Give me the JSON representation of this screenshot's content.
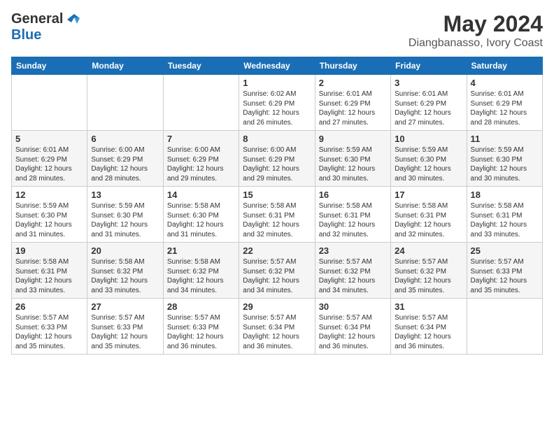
{
  "logo": {
    "line1": "General",
    "line2": "Blue"
  },
  "title": "May 2024",
  "location": "Diangbanasso, Ivory Coast",
  "headers": [
    "Sunday",
    "Monday",
    "Tuesday",
    "Wednesday",
    "Thursday",
    "Friday",
    "Saturday"
  ],
  "weeks": [
    [
      {
        "day": "",
        "sunrise": "",
        "sunset": "",
        "daylight": ""
      },
      {
        "day": "",
        "sunrise": "",
        "sunset": "",
        "daylight": ""
      },
      {
        "day": "",
        "sunrise": "",
        "sunset": "",
        "daylight": ""
      },
      {
        "day": "1",
        "sunrise": "6:02 AM",
        "sunset": "6:29 PM",
        "daylight": "12 hours and 26 minutes."
      },
      {
        "day": "2",
        "sunrise": "6:01 AM",
        "sunset": "6:29 PM",
        "daylight": "12 hours and 27 minutes."
      },
      {
        "day": "3",
        "sunrise": "6:01 AM",
        "sunset": "6:29 PM",
        "daylight": "12 hours and 27 minutes."
      },
      {
        "day": "4",
        "sunrise": "6:01 AM",
        "sunset": "6:29 PM",
        "daylight": "12 hours and 28 minutes."
      }
    ],
    [
      {
        "day": "5",
        "sunrise": "6:01 AM",
        "sunset": "6:29 PM",
        "daylight": "12 hours and 28 minutes."
      },
      {
        "day": "6",
        "sunrise": "6:00 AM",
        "sunset": "6:29 PM",
        "daylight": "12 hours and 28 minutes."
      },
      {
        "day": "7",
        "sunrise": "6:00 AM",
        "sunset": "6:29 PM",
        "daylight": "12 hours and 29 minutes."
      },
      {
        "day": "8",
        "sunrise": "6:00 AM",
        "sunset": "6:29 PM",
        "daylight": "12 hours and 29 minutes."
      },
      {
        "day": "9",
        "sunrise": "5:59 AM",
        "sunset": "6:30 PM",
        "daylight": "12 hours and 30 minutes."
      },
      {
        "day": "10",
        "sunrise": "5:59 AM",
        "sunset": "6:30 PM",
        "daylight": "12 hours and 30 minutes."
      },
      {
        "day": "11",
        "sunrise": "5:59 AM",
        "sunset": "6:30 PM",
        "daylight": "12 hours and 30 minutes."
      }
    ],
    [
      {
        "day": "12",
        "sunrise": "5:59 AM",
        "sunset": "6:30 PM",
        "daylight": "12 hours and 31 minutes."
      },
      {
        "day": "13",
        "sunrise": "5:59 AM",
        "sunset": "6:30 PM",
        "daylight": "12 hours and 31 minutes."
      },
      {
        "day": "14",
        "sunrise": "5:58 AM",
        "sunset": "6:30 PM",
        "daylight": "12 hours and 31 minutes."
      },
      {
        "day": "15",
        "sunrise": "5:58 AM",
        "sunset": "6:31 PM",
        "daylight": "12 hours and 32 minutes."
      },
      {
        "day": "16",
        "sunrise": "5:58 AM",
        "sunset": "6:31 PM",
        "daylight": "12 hours and 32 minutes."
      },
      {
        "day": "17",
        "sunrise": "5:58 AM",
        "sunset": "6:31 PM",
        "daylight": "12 hours and 32 minutes."
      },
      {
        "day": "18",
        "sunrise": "5:58 AM",
        "sunset": "6:31 PM",
        "daylight": "12 hours and 33 minutes."
      }
    ],
    [
      {
        "day": "19",
        "sunrise": "5:58 AM",
        "sunset": "6:31 PM",
        "daylight": "12 hours and 33 minutes."
      },
      {
        "day": "20",
        "sunrise": "5:58 AM",
        "sunset": "6:32 PM",
        "daylight": "12 hours and 33 minutes."
      },
      {
        "day": "21",
        "sunrise": "5:58 AM",
        "sunset": "6:32 PM",
        "daylight": "12 hours and 34 minutes."
      },
      {
        "day": "22",
        "sunrise": "5:57 AM",
        "sunset": "6:32 PM",
        "daylight": "12 hours and 34 minutes."
      },
      {
        "day": "23",
        "sunrise": "5:57 AM",
        "sunset": "6:32 PM",
        "daylight": "12 hours and 34 minutes."
      },
      {
        "day": "24",
        "sunrise": "5:57 AM",
        "sunset": "6:32 PM",
        "daylight": "12 hours and 35 minutes."
      },
      {
        "day": "25",
        "sunrise": "5:57 AM",
        "sunset": "6:33 PM",
        "daylight": "12 hours and 35 minutes."
      }
    ],
    [
      {
        "day": "26",
        "sunrise": "5:57 AM",
        "sunset": "6:33 PM",
        "daylight": "12 hours and 35 minutes."
      },
      {
        "day": "27",
        "sunrise": "5:57 AM",
        "sunset": "6:33 PM",
        "daylight": "12 hours and 35 minutes."
      },
      {
        "day": "28",
        "sunrise": "5:57 AM",
        "sunset": "6:33 PM",
        "daylight": "12 hours and 36 minutes."
      },
      {
        "day": "29",
        "sunrise": "5:57 AM",
        "sunset": "6:34 PM",
        "daylight": "12 hours and 36 minutes."
      },
      {
        "day": "30",
        "sunrise": "5:57 AM",
        "sunset": "6:34 PM",
        "daylight": "12 hours and 36 minutes."
      },
      {
        "day": "31",
        "sunrise": "5:57 AM",
        "sunset": "6:34 PM",
        "daylight": "12 hours and 36 minutes."
      },
      {
        "day": "",
        "sunrise": "",
        "sunset": "",
        "daylight": ""
      }
    ]
  ]
}
